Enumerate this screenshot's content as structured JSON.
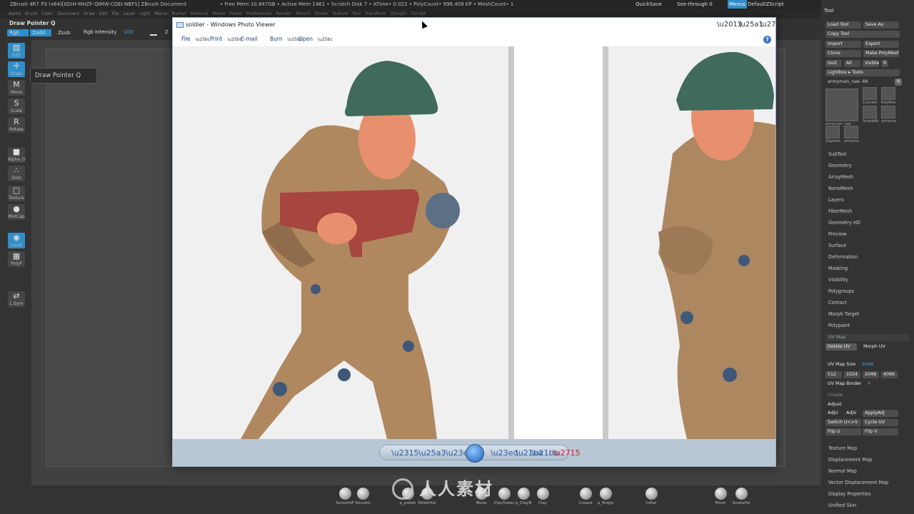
{
  "app": {
    "title_left": "ZBrush 4R7 P3 (x64)[IQSH-MHZF-QIMW-CGEI-NBFS]   ZBrush Document",
    "title_stats": "• Free Mem 10.847GB • Active Mem 1461 • Scratch Disk 7 • ATime• 0.022 • PolyCount• 996.409 KP • MeshCount• 1",
    "quicksave": "QuickSave",
    "see_through": "See-through  0",
    "menus_label": "Menus",
    "default_script": "DefaultZScript"
  },
  "menubar": [
    "Alpha",
    "Brush",
    "Color",
    "Document",
    "Draw",
    "Edit",
    "File",
    "Layer",
    "Light",
    "Macro",
    "Marker",
    "Material",
    "Movie",
    "Picker",
    "Preferences",
    "Render",
    "Stencil",
    "Stroke",
    "Texture",
    "Tool",
    "Transform",
    "Zplugin",
    "Zscript"
  ],
  "context": {
    "draw_pointer": "Draw Pointer  Q",
    "rgb": "Rgb",
    "zadd": "Zadd",
    "zsub": "Zsub",
    "rgb_intensity": "Rgb Intensity",
    "rgb_intensity_value": "100",
    "z": "Z"
  },
  "tooltip": "Draw Pointer   Q",
  "shelf": [
    {
      "label": "Edit",
      "icon": "▧",
      "active": true
    },
    {
      "label": "Draw",
      "icon": "✛",
      "active": true
    },
    {
      "label": "Move",
      "icon": "M",
      "active": false
    },
    {
      "label": "Scale",
      "icon": "S",
      "active": false
    },
    {
      "label": "Rotate",
      "icon": "R",
      "active": false
    },
    {
      "label": "Alpha_O",
      "icon": "■",
      "active": false
    },
    {
      "label": "Dots",
      "icon": "∴",
      "active": false
    },
    {
      "label": "Texture",
      "icon": "□",
      "active": false
    },
    {
      "label": "MatCap",
      "icon": "●",
      "active": false
    },
    {
      "label": "Local",
      "icon": "◉",
      "active": true
    },
    {
      "label": "PolyF",
      "icon": "▦",
      "active": false
    },
    {
      "label": "L.Sym",
      "icon": "⇄",
      "active": false
    }
  ],
  "photo_viewer": {
    "title": "soldier - Windows Photo Viewer",
    "menu": [
      "File",
      "Print",
      "E-mail",
      "Burn",
      "Open"
    ],
    "help": "?"
  },
  "tool_panel": {
    "header": "Tool",
    "buttons": [
      [
        "Load Tool",
        "Save As"
      ],
      [
        "Copy Tool",
        ""
      ],
      [
        "Import",
        "Export"
      ],
      [
        "Clone",
        "Make PolyMesh3D"
      ],
      [
        "GoZ",
        "All",
        "Visible",
        "R"
      ],
      [
        "Lightbox ▸ Tools",
        ""
      ]
    ],
    "current_tool": "armyman_raw. 48",
    "thumbs": [
      "armyman_raw",
      "Cylinder",
      "PolyMes",
      "SimpleBr",
      "armyma",
      "ZSphere",
      "armyma"
    ],
    "items": [
      "SubTool",
      "Geometry",
      "ArrayMesh",
      "NanoMesh",
      "Layers",
      "FiberMesh",
      "Geometry HD",
      "Preview",
      "Surface",
      "Deformation",
      "Masking",
      "Visibility",
      "Polygroups",
      "Contact",
      "Morph Target",
      "Polypaint"
    ],
    "uvmap": {
      "header": "UV Map",
      "delete_uv": "Delete UV",
      "morph_uv": "Morph UV",
      "size_label": "UV Map Size",
      "size_value": "2048",
      "sizes": [
        "512",
        "1024",
        "2048",
        "4096"
      ],
      "border_label": "UV Map Border",
      "border_value": "4",
      "create": "Create",
      "adjust": "Adjust",
      "adju": "AdjU",
      "adjv": "AdjV",
      "apply_adj": "ApplyAdj",
      "switch_uv": "Switch U<>V",
      "cycle_uv": "Cycle UV",
      "flip_u": "Flip U",
      "flip_v": "Flip V"
    },
    "items_after": [
      "Texture Map",
      "Displacement Map",
      "Normal Map",
      "Vector Displacement Map",
      "Display Properties",
      "Unified Skin"
    ]
  },
  "brushes": [
    "SmoothP",
    "Smooth",
    "p_polish",
    "PolishHal",
    "Move",
    "ClayTubes",
    "p_ClayB",
    "Clay",
    "Crease",
    "p_Ridge",
    "Inflat",
    "Pinch",
    "SnakeHo"
  ],
  "watermark": "人人素材"
}
